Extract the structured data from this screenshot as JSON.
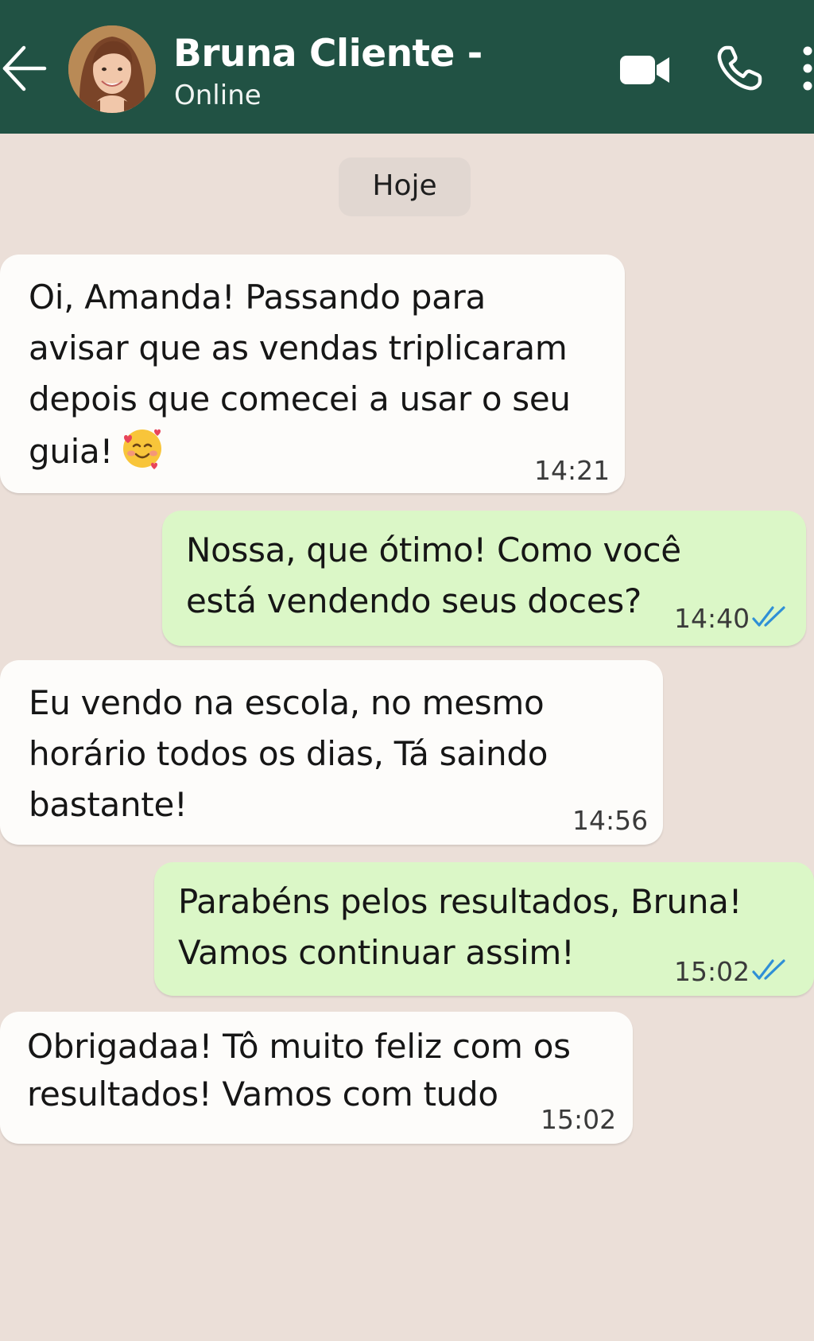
{
  "header": {
    "contact_name": "Bruna Cliente -",
    "status": "Online",
    "icons": [
      "back-arrow-icon",
      "avatar",
      "video-call-icon",
      "phone-icon",
      "more-options-icon"
    ],
    "background_color": "#215244"
  },
  "chat": {
    "date_label": "Hoje",
    "background_color": "#ebdfd8",
    "incoming_bubble_color": "#fdfcfa",
    "outgoing_bubble_color": "#dbf7c7",
    "tick_color": "#2f8fd6",
    "messages": [
      {
        "direction": "incoming",
        "lines": [
          "Oi, Amanda! Passando para",
          "avisar que as vendas triplicaram",
          "depois que comecei a usar o seu",
          "guia!"
        ],
        "emoji": "smiling-face-with-hearts",
        "time": "14:21"
      },
      {
        "direction": "outgoing",
        "lines": [
          "Nossa, que ótimo! Como você",
          "está vendendo seus doces?"
        ],
        "time": "14:40",
        "status": "read"
      },
      {
        "direction": "incoming",
        "lines": [
          "Eu vendo na escola, no mesmo",
          "horário todos os dias, Tá saindo",
          "bastante!"
        ],
        "time": "14:56"
      },
      {
        "direction": "outgoing",
        "lines": [
          "Parabéns pelos resultados, Bruna!",
          "Vamos continuar assim!"
        ],
        "time": "15:02",
        "status": "read"
      },
      {
        "direction": "incoming",
        "lines": [
          "Obrigadaa! Tô muito feliz com os",
          "resultados! Vamos com tudo"
        ],
        "time": "15:02"
      }
    ]
  }
}
